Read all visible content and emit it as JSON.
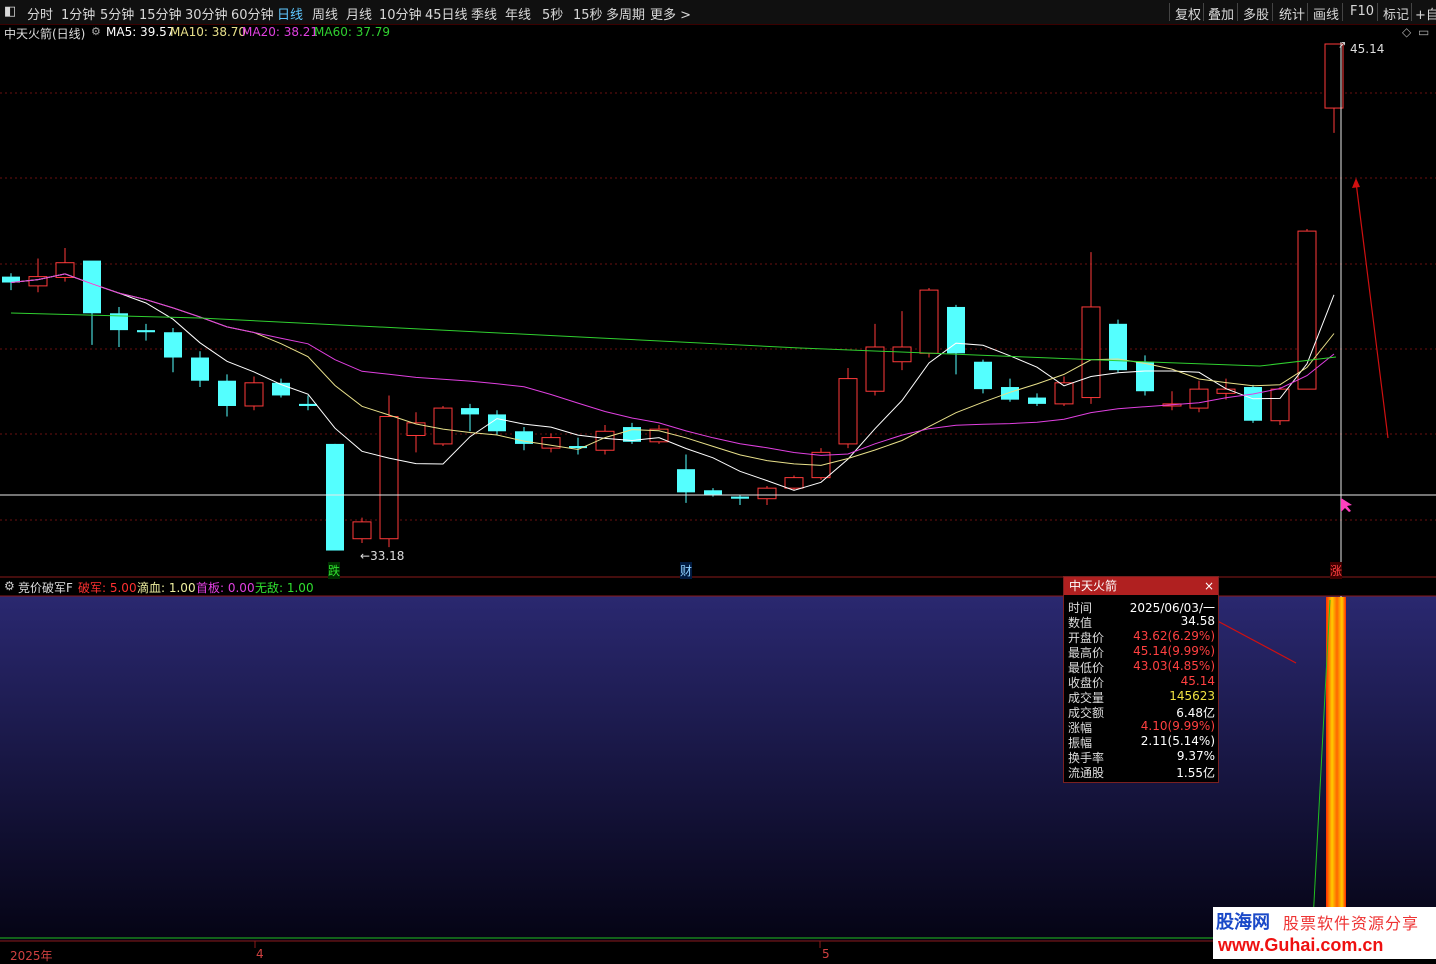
{
  "toolbar": {
    "periods": [
      "分时",
      "1分钟",
      "5分钟",
      "15分钟",
      "30分钟",
      "60分钟",
      "日线",
      "周线",
      "月线",
      "10分钟",
      "45日线",
      "季线",
      "年线",
      "5秒",
      "15秒",
      "多周期",
      "更多 >"
    ],
    "active": "日线",
    "right_buttons": [
      "复权",
      "叠加",
      "多股",
      "统计",
      "画线",
      "F10",
      "标记",
      "+自"
    ]
  },
  "main_chart": {
    "title": "中天火箭(日线)",
    "ma": [
      {
        "label": "MA5: 39.57",
        "color": "#ffffff"
      },
      {
        "label": "MA10: 38.70",
        "color": "#e8e08a"
      },
      {
        "label": "MA20: 38.21",
        "color": "#e040e0"
      },
      {
        "label": "MA60: 37.79",
        "color": "#30d030"
      }
    ],
    "high_label": "45.14",
    "low_label": "33.18",
    "markers": [
      "跌",
      "财",
      "涨"
    ],
    "diamond": "◇"
  },
  "sub_chart": {
    "title": "竞价破军F",
    "params": [
      {
        "label": "破军: 5.00",
        "color": "#ff3030"
      },
      {
        "label": "滴血: 1.00",
        "color": "#f0f0a0"
      },
      {
        "label": "首板: 0.00",
        "color": "#e040e0"
      },
      {
        "label": "无敌: 1.00",
        "color": "#30e030"
      }
    ]
  },
  "popup": {
    "title": "中天火箭",
    "close": "×",
    "rows": [
      {
        "k": "时间",
        "v": "2025/06/03/一",
        "color": "#ffffff"
      },
      {
        "k": "数值",
        "v": "34.58",
        "color": "#ffffff"
      },
      {
        "k": "开盘价",
        "v": "43.62(6.29%)",
        "color": "#ff4040"
      },
      {
        "k": "最高价",
        "v": "45.14(9.99%)",
        "color": "#ff4040"
      },
      {
        "k": "最低价",
        "v": "43.03(4.85%)",
        "color": "#ff4040"
      },
      {
        "k": "收盘价",
        "v": "45.14",
        "color": "#ff4040"
      },
      {
        "k": "成交量",
        "v": "145623",
        "color": "#f0e040"
      },
      {
        "k": "成交额",
        "v": "6.48亿",
        "color": "#ffffff"
      },
      {
        "k": "涨幅",
        "v": "4.10(9.99%)",
        "color": "#ff4040"
      },
      {
        "k": "振幅",
        "v": "2.11(5.14%)",
        "color": "#ffffff"
      },
      {
        "k": "换手率",
        "v": "9.37%",
        "color": "#ffffff"
      },
      {
        "k": "流通股",
        "v": "1.55亿",
        "color": "#ffffff"
      }
    ]
  },
  "xaxis": {
    "labels": [
      "2025年",
      "4",
      "5"
    ]
  },
  "watermark": {
    "brand": "股海网",
    "slogan": "股票软件资源分享",
    "url": "www.Guhai.com.cn"
  }
}
